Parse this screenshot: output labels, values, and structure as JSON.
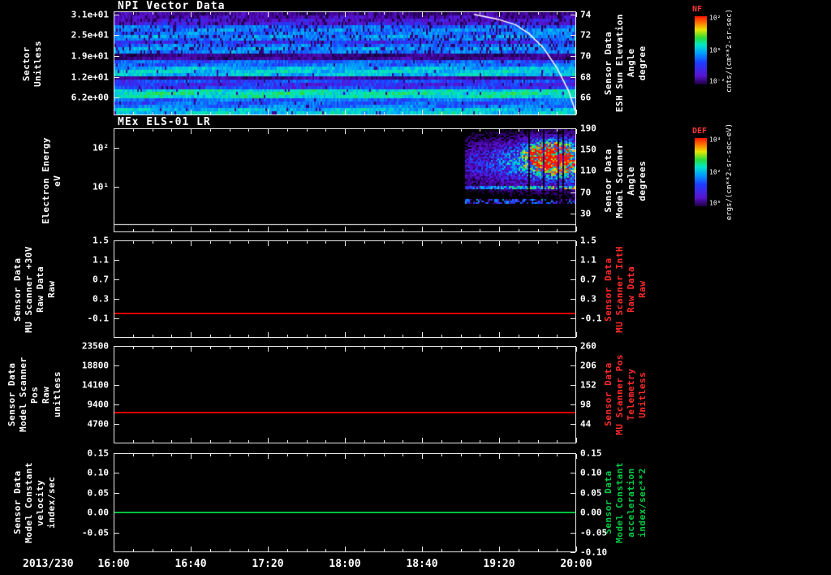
{
  "date_label": "2013/230",
  "time_ticks": [
    {
      "label": "16:00",
      "frac": 0
    },
    {
      "label": "16:40",
      "frac": 0.1667
    },
    {
      "label": "17:20",
      "frac": 0.3333
    },
    {
      "label": "18:00",
      "frac": 0.5
    },
    {
      "label": "18:40",
      "frac": 0.6667
    },
    {
      "label": "19:20",
      "frac": 0.8333
    },
    {
      "label": "20:00",
      "frac": 1
    }
  ],
  "panels": [
    {
      "id": "npi",
      "title": "NPI Vector Data",
      "left_label": "Sector\nUnitless",
      "right_label": "Sensor Data\nESH Sun Elevation\nAngle\ndegree",
      "left_ticks": [
        {
          "label": "3.1e+01",
          "frac": 0.03
        },
        {
          "label": "2.5e+01",
          "frac": 0.23
        },
        {
          "label": "1.9e+01",
          "frac": 0.43
        },
        {
          "label": "1.2e+01",
          "frac": 0.63
        },
        {
          "label": "6.2e+00",
          "frac": 0.83
        }
      ],
      "right_ticks": [
        {
          "label": "74",
          "frac": 0.03
        },
        {
          "label": "72",
          "frac": 0.23
        },
        {
          "label": "70",
          "frac": 0.43
        },
        {
          "label": "68",
          "frac": 0.63
        },
        {
          "label": "66",
          "frac": 0.83
        }
      ]
    },
    {
      "id": "els",
      "title": "MEx ELS-01 LR",
      "left_label": "Electron Energy\neV",
      "right_label": "Sensor Data\nModel Scanner\nAngle\ndegrees",
      "left_ticks": [
        {
          "label": "10²",
          "frac": 0.19
        },
        {
          "label": "10¹",
          "frac": 0.56
        }
      ],
      "right_ticks": [
        {
          "label": "190",
          "frac": 0.0
        },
        {
          "label": "150",
          "frac": 0.2
        },
        {
          "label": "110",
          "frac": 0.41
        },
        {
          "label": "70",
          "frac": 0.62
        },
        {
          "label": "30",
          "frac": 0.82
        }
      ]
    },
    {
      "id": "mu_scanner",
      "left_label": "Sensor Data\nMU Scanner +30V\nRaw Data\nRaw",
      "right_label": "Sensor Data\nMU Scanner IntH\nRaw Data\nRaw",
      "left_ticks": [
        {
          "label": "1.5",
          "frac": 0
        },
        {
          "label": "1.1",
          "frac": 0.2
        },
        {
          "label": "0.7",
          "frac": 0.4
        },
        {
          "label": "0.3",
          "frac": 0.6
        },
        {
          "label": "-0.1",
          "frac": 0.8
        }
      ],
      "right_ticks": [
        {
          "label": "1.5",
          "frac": 0
        },
        {
          "label": "1.1",
          "frac": 0.2
        },
        {
          "label": "0.7",
          "frac": 0.4
        },
        {
          "label": "0.3",
          "frac": 0.6
        },
        {
          "label": "-0.1",
          "frac": 0.8
        }
      ]
    },
    {
      "id": "scanner_pos",
      "left_label": "Sensor Data\nModel Scanner Pos\nRaw\nunitless",
      "right_label": "Sensor Data\nMU Scanner Pos\nTelemetry\nUnitless",
      "left_ticks": [
        {
          "label": "23500",
          "frac": 0
        },
        {
          "label": "18800",
          "frac": 0.2
        },
        {
          "label": "14100",
          "frac": 0.4
        },
        {
          "label": "9400",
          "frac": 0.6
        },
        {
          "label": "4700",
          "frac": 0.8
        }
      ],
      "right_ticks": [
        {
          "label": "260",
          "frac": 0
        },
        {
          "label": "206",
          "frac": 0.2
        },
        {
          "label": "152",
          "frac": 0.4
        },
        {
          "label": "98",
          "frac": 0.6
        },
        {
          "label": "44",
          "frac": 0.8
        }
      ]
    },
    {
      "id": "model_constant",
      "left_label": "Sensor Data\nModel Constant\nvelocity\nindex/sec",
      "right_label": "Sensor Data\nModel Constant\nacceleration\nindex/sec**2",
      "left_ticks": [
        {
          "label": "0.15",
          "frac": 0
        },
        {
          "label": "0.10",
          "frac": 0.2
        },
        {
          "label": "0.05",
          "frac": 0.4
        },
        {
          "label": "0.00",
          "frac": 0.6
        },
        {
          "label": "-0.05",
          "frac": 0.8
        }
      ],
      "right_ticks": [
        {
          "label": "0.15",
          "frac": 0
        },
        {
          "label": "0.10",
          "frac": 0.2
        },
        {
          "label": "0.05",
          "frac": 0.4
        },
        {
          "label": "0.00",
          "frac": 0.6
        },
        {
          "label": "-0.05",
          "frac": 0.8
        },
        {
          "label": "-0.10",
          "frac": 1
        }
      ]
    }
  ],
  "colorbars": [
    {
      "id": "nf",
      "title": "NF",
      "unit": "cnts/(cm**2-sr-sec)",
      "ticks": [
        {
          "label": "10²",
          "frac": 0.02
        },
        {
          "label": "10⁰",
          "frac": 0.5
        },
        {
          "label": "10⁻²",
          "frac": 0.95
        }
      ]
    },
    {
      "id": "def",
      "title": "DEF",
      "unit": "ergs/(cm**2-sr-sec-eV)",
      "ticks": [
        {
          "label": "10⁴",
          "frac": 0.02
        },
        {
          "label": "10²",
          "frac": 0.5
        },
        {
          "label": "10⁰",
          "frac": 0.95
        }
      ]
    }
  ],
  "chart_data": [
    {
      "id": "npi",
      "type": "heatmap",
      "title": "NPI Vector Data",
      "x_range": [
        "16:00",
        "20:00"
      ],
      "x_date": "2013/230",
      "ylabel": "Sector (Unitless)",
      "y_ticks": [
        "3.1e+01",
        "2.5e+01",
        "1.9e+01",
        "1.2e+01",
        "6.2e+00"
      ],
      "zlabel": "NF cnts/(cm**2-sr-sec)",
      "z_scale": "log",
      "z_ticks": [
        "10²",
        "10⁰",
        "10⁻²"
      ],
      "rows": 32,
      "row_intensity": [
        0.16,
        0.2,
        0.24,
        0.27,
        0.4,
        0.44,
        0.42,
        0.46,
        0.43,
        0.32,
        0.41,
        0.46,
        0.43,
        0.12,
        0.14,
        0.39,
        0.41,
        0.5,
        0.54,
        0.52,
        0.16,
        0.36,
        0.31,
        0.34,
        0.56,
        0.6,
        0.57,
        0.41,
        0.39,
        0.43,
        0.52,
        0.54
      ],
      "overlay": {
        "name": "ESH Sun Elevation Angle (degree)",
        "color": "#ffffff",
        "y_range": [
          65.5,
          74.5
        ],
        "right_ticks": [
          "74",
          "72",
          "70",
          "68",
          "66"
        ],
        "points_x": [
          0.78,
          0.83,
          0.87,
          0.9,
          0.93,
          0.96,
          0.985,
          1.0
        ],
        "points_y": [
          74.3,
          73.9,
          73.4,
          72.6,
          71.4,
          69.6,
          67.6,
          65.8
        ]
      }
    },
    {
      "id": "els",
      "type": "heatmap",
      "title": "MEx ELS-01 LR",
      "x_range": [
        "16:00",
        "20:00"
      ],
      "ylabel": "Electron Energy (eV)",
      "y_scale": "log",
      "y_ticks": [
        "10²",
        "10¹"
      ],
      "right_ylabel": "Sensor Data Model Scanner Angle (degrees)",
      "right_y_ticks": [
        "190",
        "150",
        "110",
        "70",
        "30"
      ],
      "zlabel": "DEF ergs/(cm**2-sr-sec-eV)",
      "z_scale": "log",
      "z_ticks": [
        "10⁴",
        "10²",
        "10⁰"
      ],
      "blob": {
        "x_start": 0.76,
        "y_center": 0.32,
        "y_sigma": 0.16,
        "core_x_center": 0.945,
        "core_x_sigma": 0.032,
        "core_y_center": 0.26,
        "core_y_sigma": 0.09
      },
      "sub_band_y": 0.7,
      "baseline_frac": 0.93
    },
    {
      "id": "mu_scanner",
      "type": "line",
      "ylim": [
        -0.5,
        1.5
      ],
      "left_ylabel": "Sensor Data MU Scanner +30V Raw Data (Raw)",
      "right_ylabel": "Sensor Data MU Scanner IntH Raw Data (Raw)",
      "y_ticks": [
        "1.5",
        "1.1",
        "0.7",
        "0.3",
        "-0.1"
      ],
      "series": [
        {
          "name": "MU Scanner +30V Raw",
          "color": "#e00000",
          "value": 0.0,
          "shape": "constant"
        }
      ]
    },
    {
      "id": "scanner_pos",
      "type": "line",
      "ylim": [
        0,
        23500
      ],
      "left_ylabel": "Sensor Data Model Scanner Pos Raw (unitless)",
      "right_ylabel": "Sensor Data MU Scanner Pos Telemetry (Unitless)",
      "y_ticks": [
        "23500",
        "18800",
        "14100",
        "9400",
        "4700"
      ],
      "right_y_ticks": [
        "260",
        "206",
        "152",
        "98",
        "44"
      ],
      "series": [
        {
          "name": "Model Scanner Pos Raw",
          "color": "#e00000",
          "value": 7400,
          "shape": "constant"
        }
      ]
    },
    {
      "id": "model_constant",
      "type": "line",
      "ylim": [
        -0.1,
        0.15
      ],
      "left_ylabel": "Sensor Data Model Constant velocity (index/sec)",
      "right_ylabel": "Sensor Data Model Constant acceleration (index/sec**2)",
      "y_ticks": [
        "0.15",
        "0.10",
        "0.05",
        "0.00",
        "-0.05",
        "-0.10"
      ],
      "series": [
        {
          "name": "Model Constant velocity",
          "color": "#00c040",
          "value": 0.0,
          "shape": "constant"
        }
      ]
    }
  ]
}
